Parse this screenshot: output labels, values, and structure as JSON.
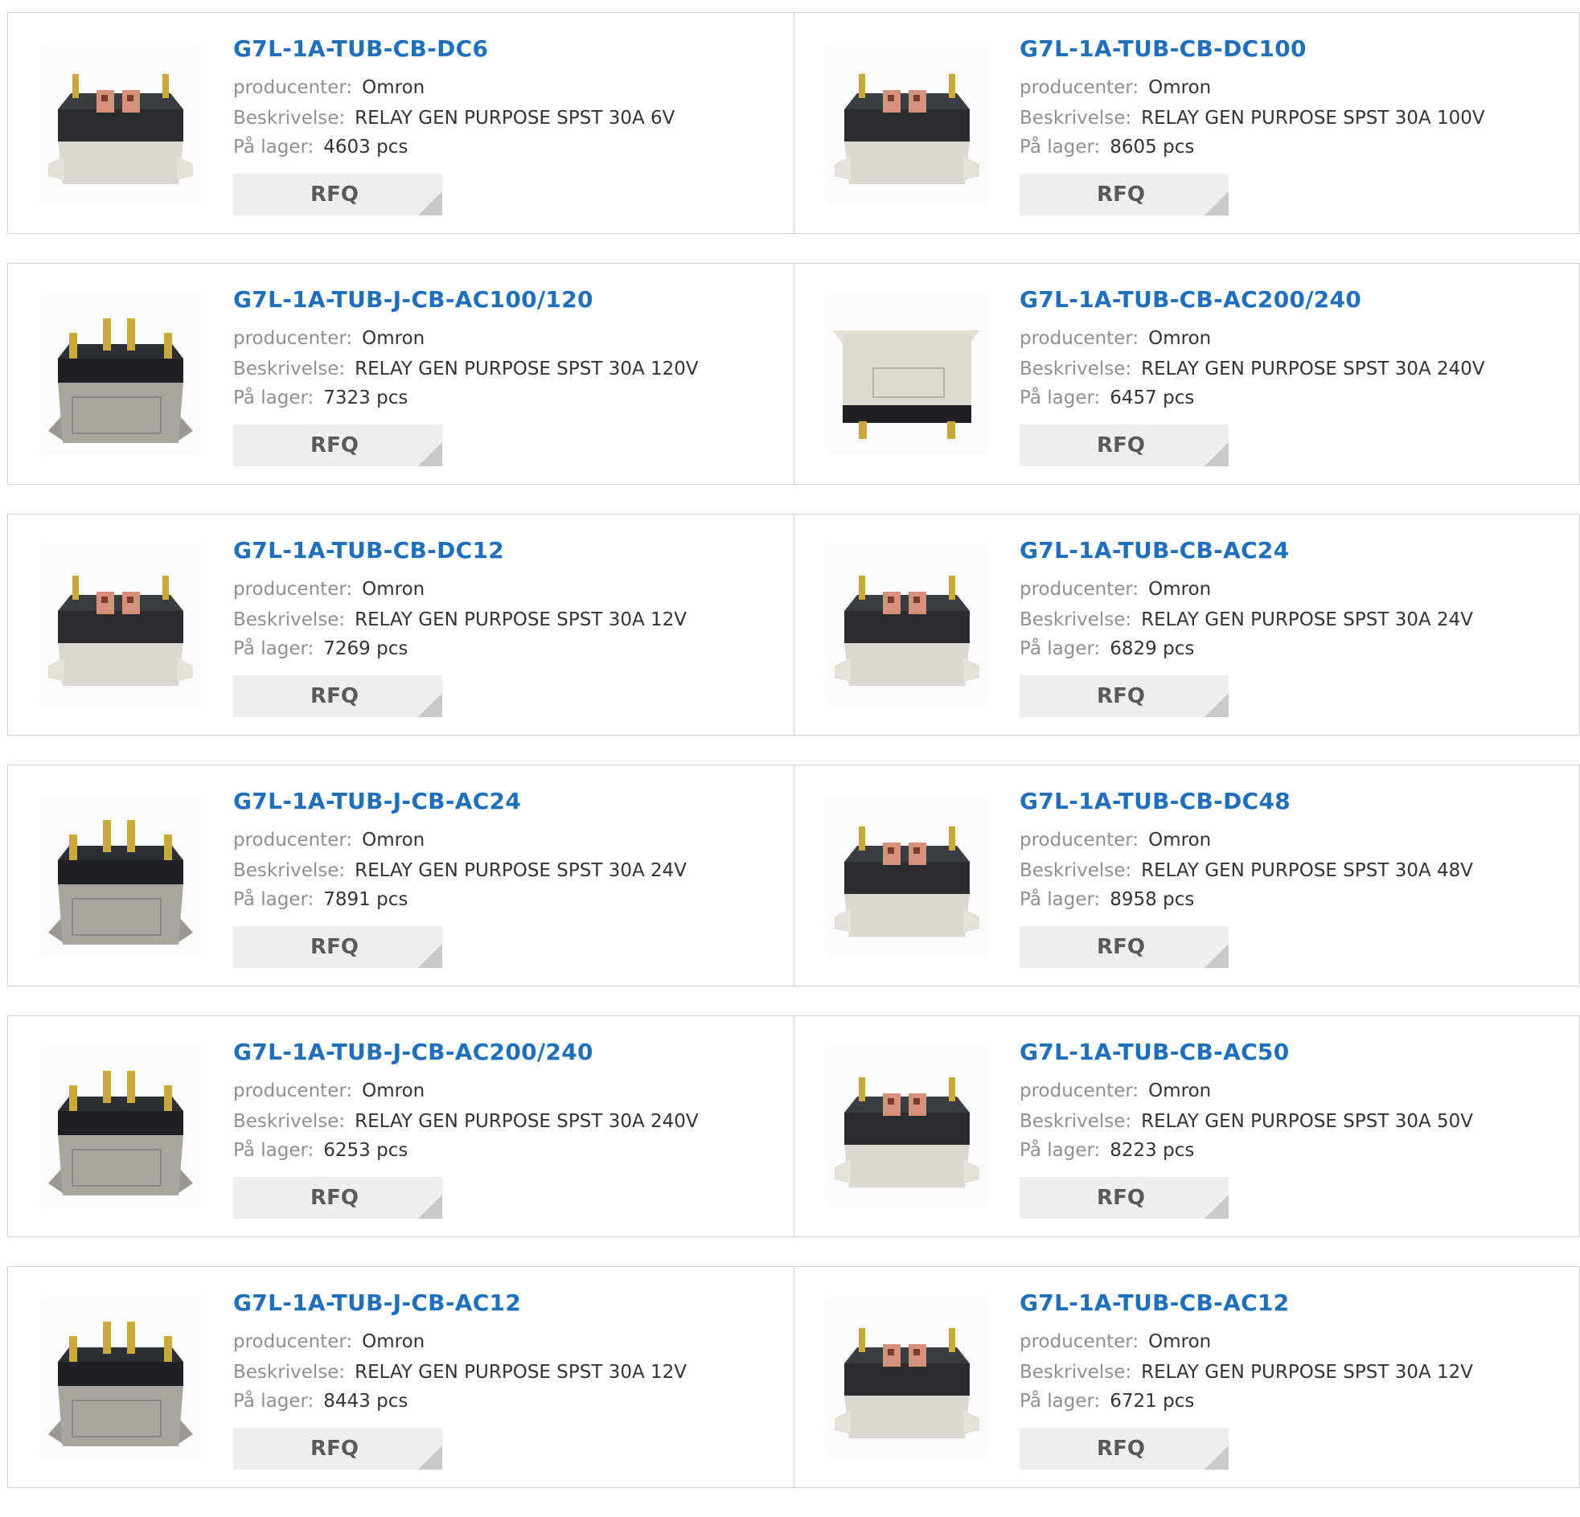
{
  "labels": {
    "manufacturer": "producenter:",
    "description": "Beskrivelse:",
    "stock": "På lager:",
    "rfq": "RFQ"
  },
  "products": [
    {
      "part": "G7L-1A-TUB-CB-DC6",
      "manufacturer": "Omron",
      "description": "RELAY GEN PURPOSE SPST 30A 6V",
      "stock": "4603 pcs",
      "image": "relay-cb-icon"
    },
    {
      "part": "G7L-1A-TUB-CB-DC100",
      "manufacturer": "Omron",
      "description": "RELAY GEN PURPOSE SPST 30A 100V",
      "stock": "8605 pcs",
      "image": "relay-cb-icon"
    },
    {
      "part": "G7L-1A-TUB-J-CB-AC100/120",
      "manufacturer": "Omron",
      "description": "RELAY GEN PURPOSE SPST 30A 120V",
      "stock": "7323 pcs",
      "image": "relay-j-icon"
    },
    {
      "part": "G7L-1A-TUB-CB-AC200/240",
      "manufacturer": "Omron",
      "description": "RELAY GEN PURPOSE SPST 30A 240V",
      "stock": "6457 pcs",
      "image": "relay-flat-icon"
    },
    {
      "part": "G7L-1A-TUB-CB-DC12",
      "manufacturer": "Omron",
      "description": "RELAY GEN PURPOSE SPST 30A 12V",
      "stock": "7269 pcs",
      "image": "relay-cb-icon"
    },
    {
      "part": "G7L-1A-TUB-CB-AC24",
      "manufacturer": "Omron",
      "description": "RELAY GEN PURPOSE SPST 30A 24V",
      "stock": "6829 pcs",
      "image": "relay-cb-icon"
    },
    {
      "part": "G7L-1A-TUB-J-CB-AC24",
      "manufacturer": "Omron",
      "description": "RELAY GEN PURPOSE SPST 30A 24V",
      "stock": "7891 pcs",
      "image": "relay-j-icon"
    },
    {
      "part": "G7L-1A-TUB-CB-DC48",
      "manufacturer": "Omron",
      "description": "RELAY GEN PURPOSE SPST 30A 48V",
      "stock": "8958 pcs",
      "image": "relay-cb-icon"
    },
    {
      "part": "G7L-1A-TUB-J-CB-AC200/240",
      "manufacturer": "Omron",
      "description": "RELAY GEN PURPOSE SPST 30A 240V",
      "stock": "6253 pcs",
      "image": "relay-j-icon"
    },
    {
      "part": "G7L-1A-TUB-CB-AC50",
      "manufacturer": "Omron",
      "description": "RELAY GEN PURPOSE SPST 30A 50V",
      "stock": "8223 pcs",
      "image": "relay-cb-icon"
    },
    {
      "part": "G7L-1A-TUB-J-CB-AC12",
      "manufacturer": "Omron",
      "description": "RELAY GEN PURPOSE SPST 30A 12V",
      "stock": "8443 pcs",
      "image": "relay-j-icon"
    },
    {
      "part": "G7L-1A-TUB-CB-AC12",
      "manufacturer": "Omron",
      "description": "RELAY GEN PURPOSE SPST 30A 12V",
      "stock": "6721 pcs",
      "image": "relay-cb-icon"
    }
  ],
  "colors": {
    "title": "#1f6fba",
    "label": "#8f8f8f",
    "value": "#333333",
    "button_bg": "#eeeeee",
    "border": "#d2d2d2"
  }
}
